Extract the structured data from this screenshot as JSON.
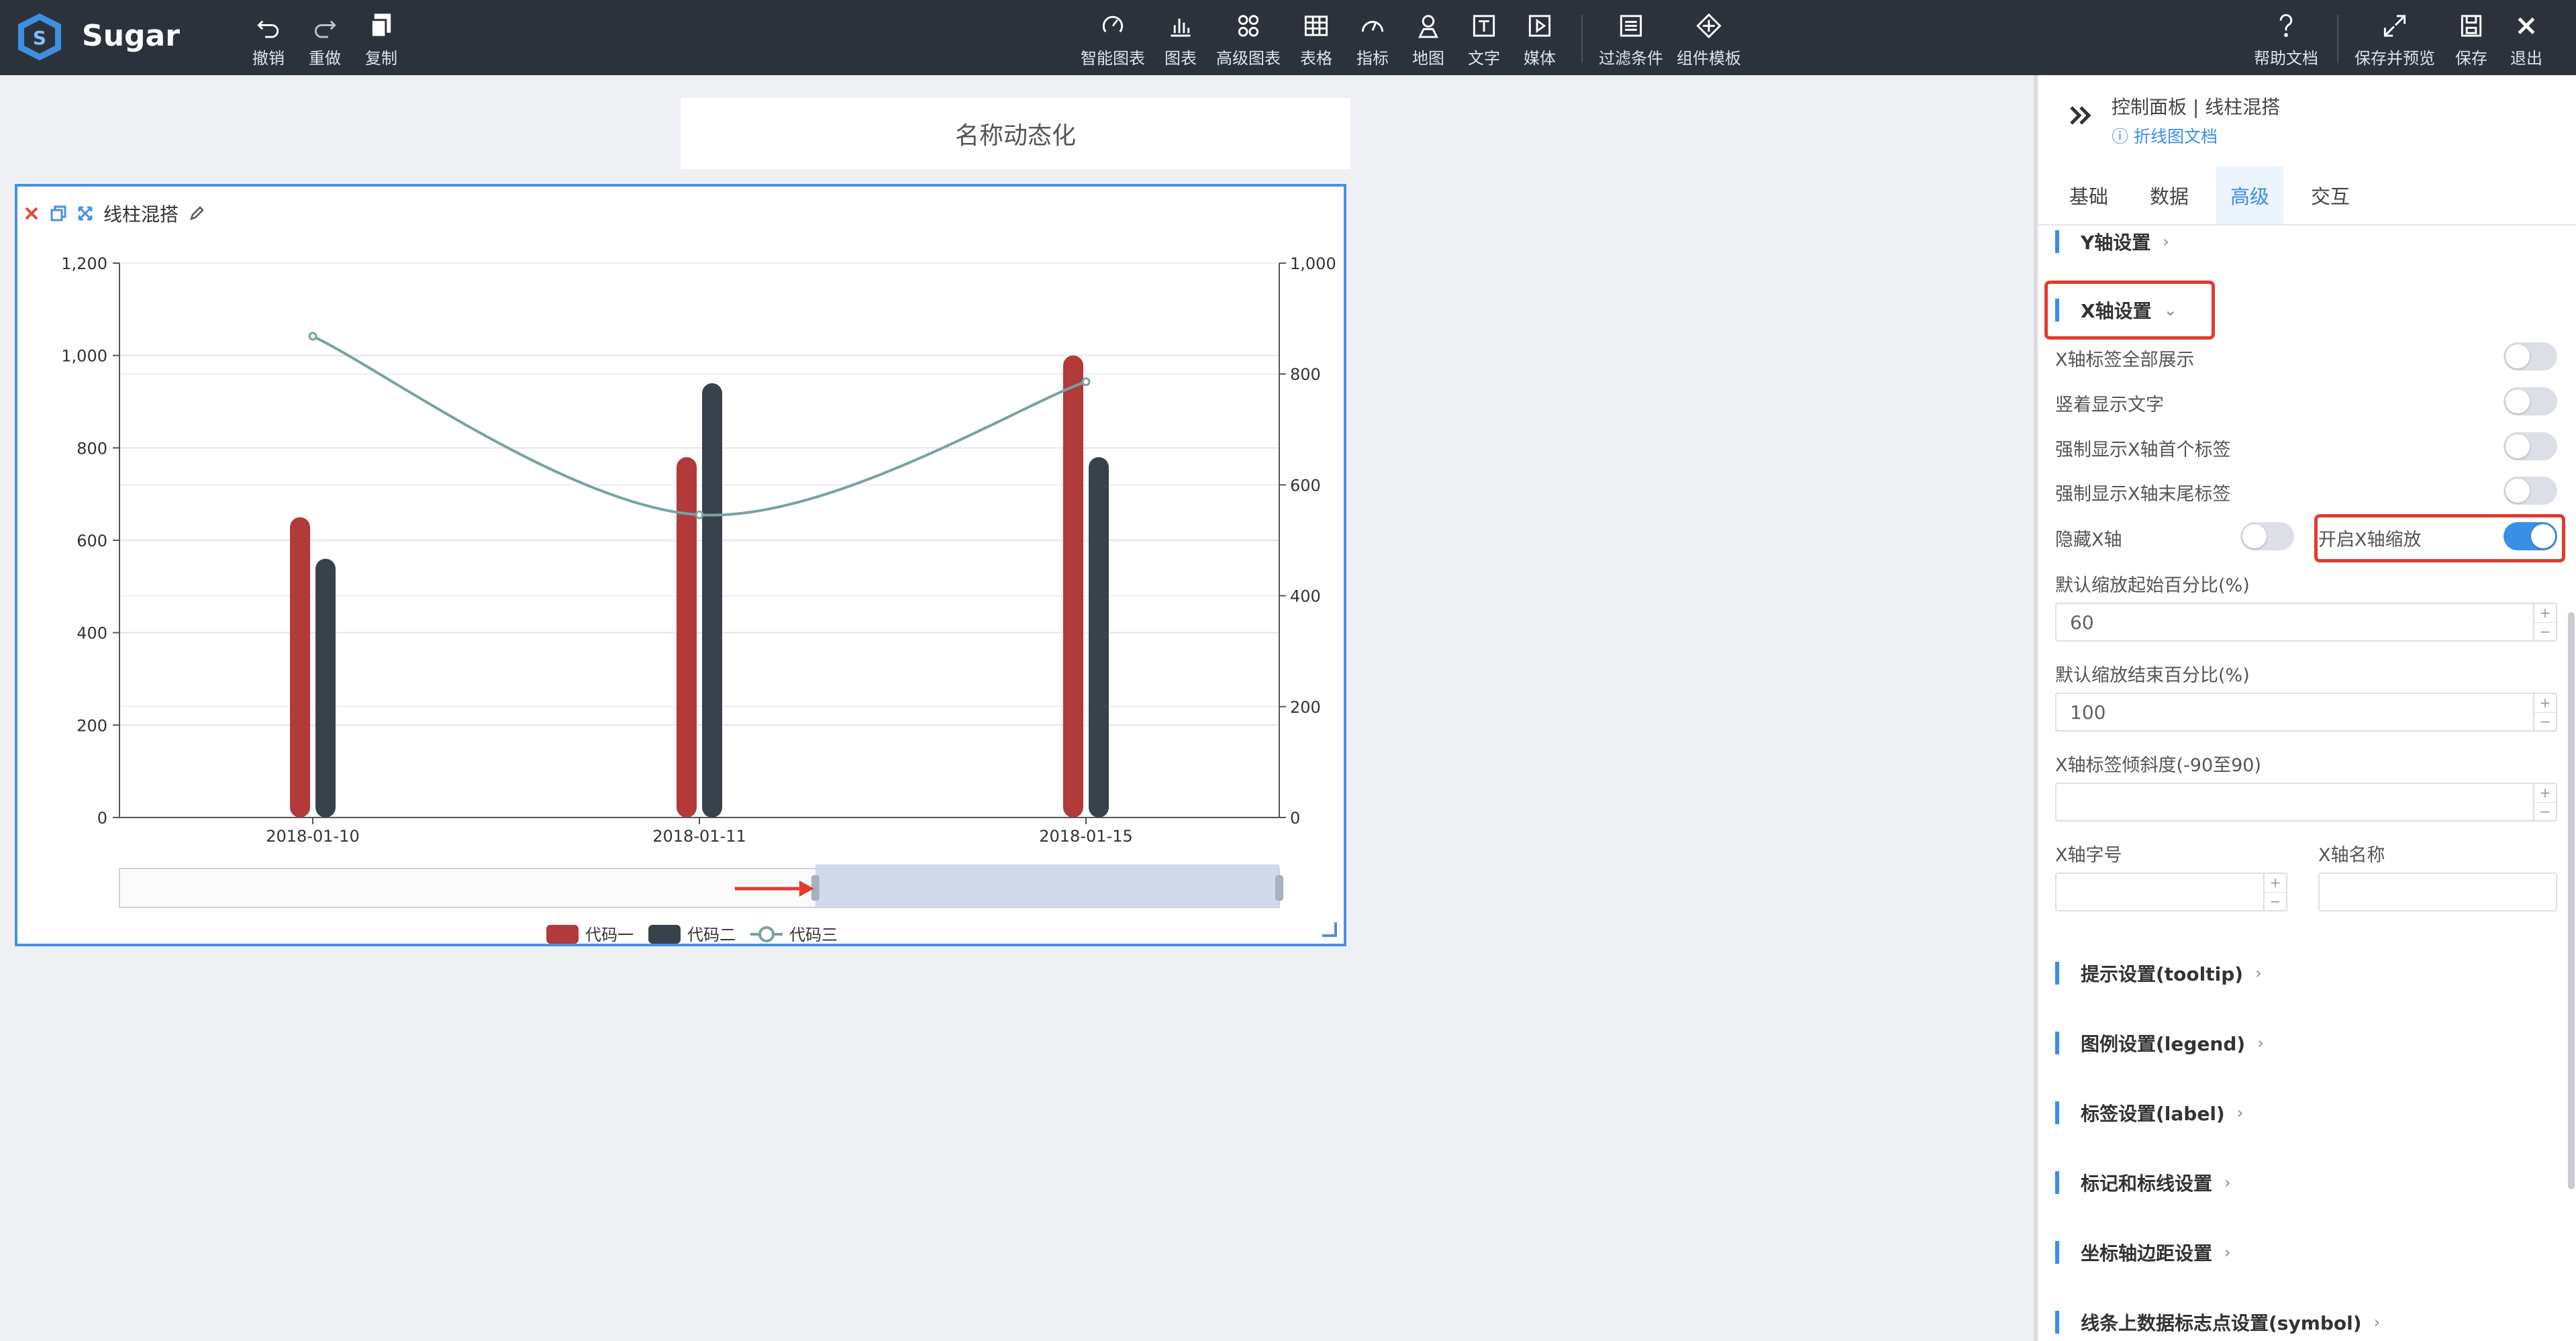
{
  "app": {
    "name": "Sugar"
  },
  "toolbar": {
    "undo": "撤销",
    "redo": "重做",
    "copy": "复制",
    "smart_chart": "智能图表",
    "chart": "图表",
    "advanced_chart": "高级图表",
    "table": "表格",
    "metric": "指标",
    "map": "地图",
    "text": "文字",
    "media": "媒体",
    "filter": "过滤条件",
    "component_template": "组件模板",
    "help": "帮助文档",
    "save_preview": "保存并预览",
    "save": "保存",
    "exit": "退出"
  },
  "canvas": {
    "title_text": "名称动态化",
    "widget_title": "线柱混搭"
  },
  "chart_data": {
    "type": "bar",
    "categories": [
      "2018-01-10",
      "2018-01-11",
      "2018-01-15"
    ],
    "series": [
      {
        "name": "代码一",
        "type": "bar",
        "axis": "left",
        "color": "#b33a3a",
        "values": [
          650,
          780,
          1000
        ]
      },
      {
        "name": "代码二",
        "type": "bar",
        "axis": "left",
        "color": "#38424d",
        "values": [
          560,
          940,
          780
        ]
      },
      {
        "name": "代码三",
        "type": "line",
        "axis": "right",
        "color": "#78a2a0",
        "smooth": true,
        "values": [
          868,
          546,
          786
        ]
      }
    ],
    "y_left": {
      "min": 0,
      "max": 1200,
      "ticks": [
        "0",
        "200",
        "400",
        "600",
        "800",
        "1,000",
        "1,200"
      ]
    },
    "y_right": {
      "min": 0,
      "max": 1000,
      "ticks": [
        "0",
        "200",
        "400",
        "600",
        "800",
        "1,000"
      ]
    },
    "grid": true,
    "legend_position": "bottom",
    "datazoom": {
      "start": 60,
      "end": 100
    }
  },
  "panel": {
    "breadcrumb": "控制面板 | 线柱混搭",
    "doc_link": "折线图文档",
    "tabs": [
      "基础",
      "数据",
      "高级",
      "交互"
    ],
    "active_tab": "高级",
    "y_axis_section": "Y轴设置",
    "x_axis_section": "X轴设置",
    "options": {
      "show_all_labels": "X轴标签全部展示",
      "vertical_text": "竖着显示文字",
      "force_first": "强制显示X轴首个标签",
      "force_last": "强制显示X轴末尾标签",
      "hide_axis": "隐藏X轴",
      "enable_zoom": "开启X轴缩放"
    },
    "zoom_start_label": "默认缩放起始百分比(%)",
    "zoom_start_value": "60",
    "zoom_end_label": "默认缩放结束百分比(%)",
    "zoom_end_value": "100",
    "tilt_label": "X轴标签倾斜度(-90至90)",
    "font_size_label": "X轴字号",
    "axis_name_label": "X轴名称",
    "sections": [
      "提示设置(tooltip)",
      "图例设置(legend)",
      "标签设置(label)",
      "标记和标线设置",
      "坐标轴边距设置",
      "线条上数据标志点设置(symbol)"
    ]
  }
}
